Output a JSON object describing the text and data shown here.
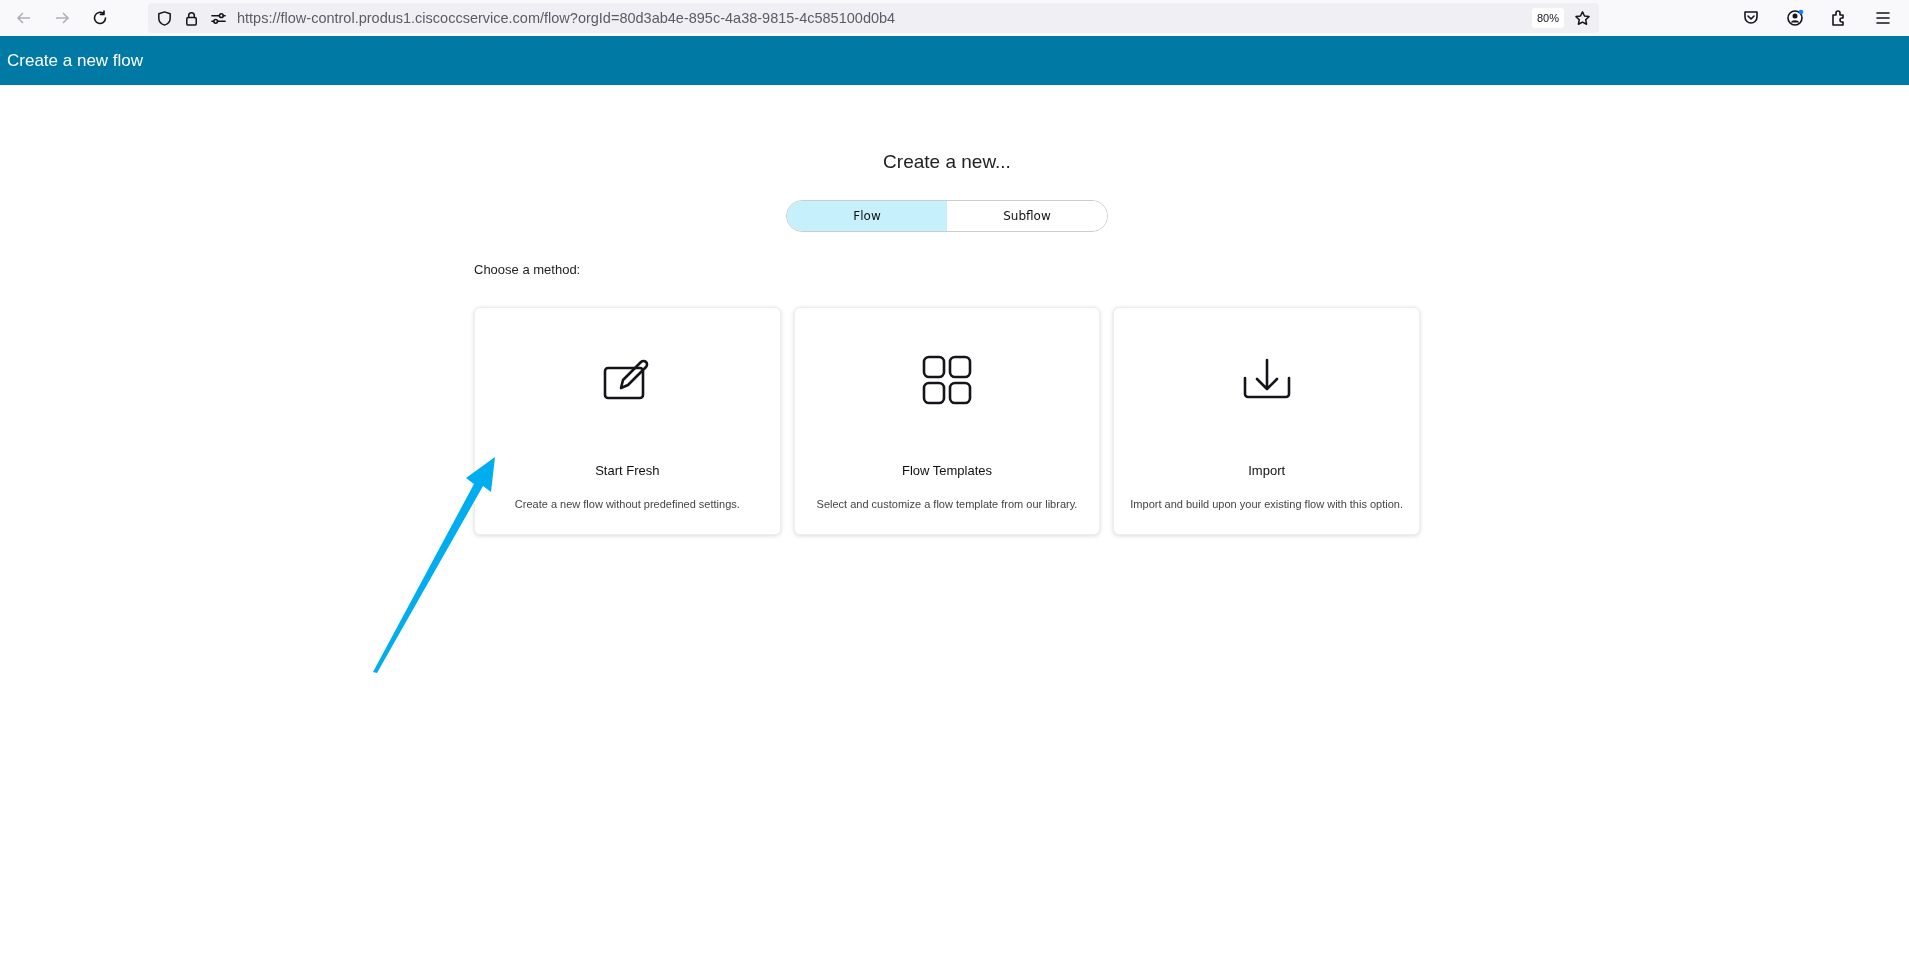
{
  "browser": {
    "url": "https://flow-control.produs1.ciscoccservice.com/flow?orgId=80d3ab4e-895c-4a38-9815-4c585100d0b4",
    "zoom": "80%"
  },
  "header": {
    "title": "Create a new flow"
  },
  "heading": "Create a new...",
  "tabs": [
    {
      "label": "Flow",
      "selected": true
    },
    {
      "label": "Subflow",
      "selected": false
    }
  ],
  "method_label": "Choose a method:",
  "cards": [
    {
      "kind": "edit",
      "title": "Start Fresh",
      "description": "Create a new flow without predefined settings."
    },
    {
      "kind": "grid",
      "title": "Flow Templates",
      "description": "Select and customize a flow template from our library."
    },
    {
      "kind": "download",
      "title": "Import",
      "description": "Import and build upon your existing flow with this option."
    }
  ]
}
